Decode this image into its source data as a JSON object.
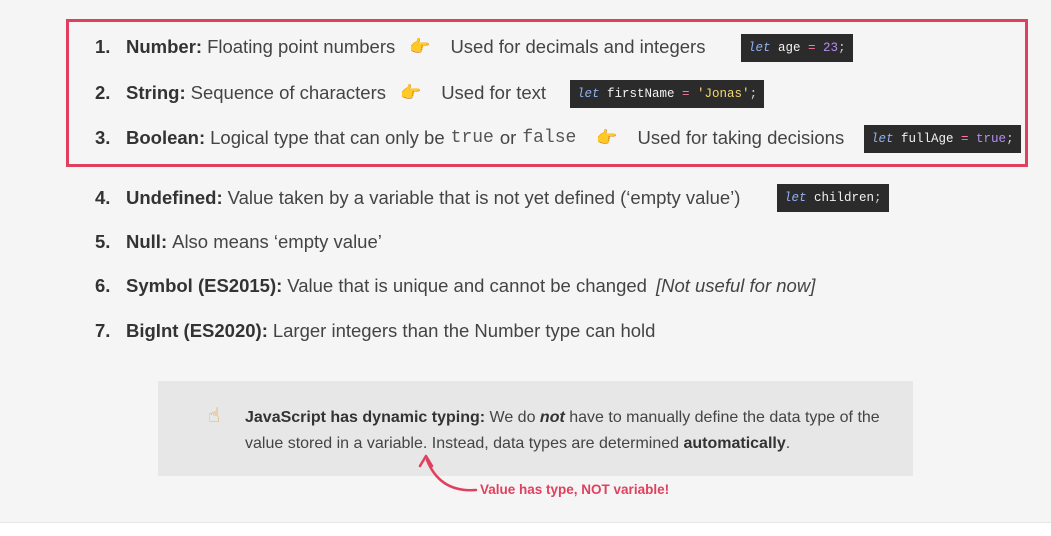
{
  "types": [
    {
      "num": "1.",
      "term": "Number:",
      "desc": "Floating point numbers",
      "use": "Used for decimals and integers",
      "code": {
        "kw": "let",
        "name": " age ",
        "op": "=",
        "val": " 23",
        "end": ";"
      }
    },
    {
      "num": "2.",
      "term": "String:",
      "desc": "Sequence of characters",
      "use": "Used for text",
      "code": {
        "kw": "let",
        "name": " firstName ",
        "op": "=",
        "val": " 'Jonas'",
        "end": ";"
      }
    },
    {
      "num": "3.",
      "term": "Boolean:",
      "desc": "Logical type that can only be",
      "mono1": "true",
      "or": "or",
      "mono2": "false",
      "use": "Used for taking decisions",
      "code": {
        "kw": "let",
        "name": " fullAge ",
        "op": "=",
        "val": " true",
        "end": ";"
      }
    },
    {
      "num": "4.",
      "term": "Undefined:",
      "desc": "Value taken by a variable that is not yet defined (‘empty value’)",
      "code": {
        "kw": "let",
        "name": " children",
        "end": ";"
      }
    },
    {
      "num": "5.",
      "term": "Null:",
      "desc": "Also means ‘empty value’"
    },
    {
      "num": "6.",
      "term": "Symbol (ES2015):",
      "desc": "Value that is unique and cannot be changed",
      "note": "[Not useful for now]"
    },
    {
      "num": "7.",
      "term": "BigInt (ES2020):",
      "desc": "Larger integers than the Number type can hold"
    }
  ],
  "note": {
    "icon": "pointing-up-hand-icon",
    "bold_lead": "JavaScript has dynamic typing:",
    "t1": " We do ",
    "emph": "not",
    "t2": " have to manually define the data type of the value stored in a variable. Instead, data types are determined ",
    "bold_end": "automatically",
    "t3": "."
  },
  "callout": "Value has type, NOT variable!",
  "colors": {
    "accent": "#e0405e",
    "code_bg": "#2b2b2b",
    "hand": "#e8a43a"
  }
}
